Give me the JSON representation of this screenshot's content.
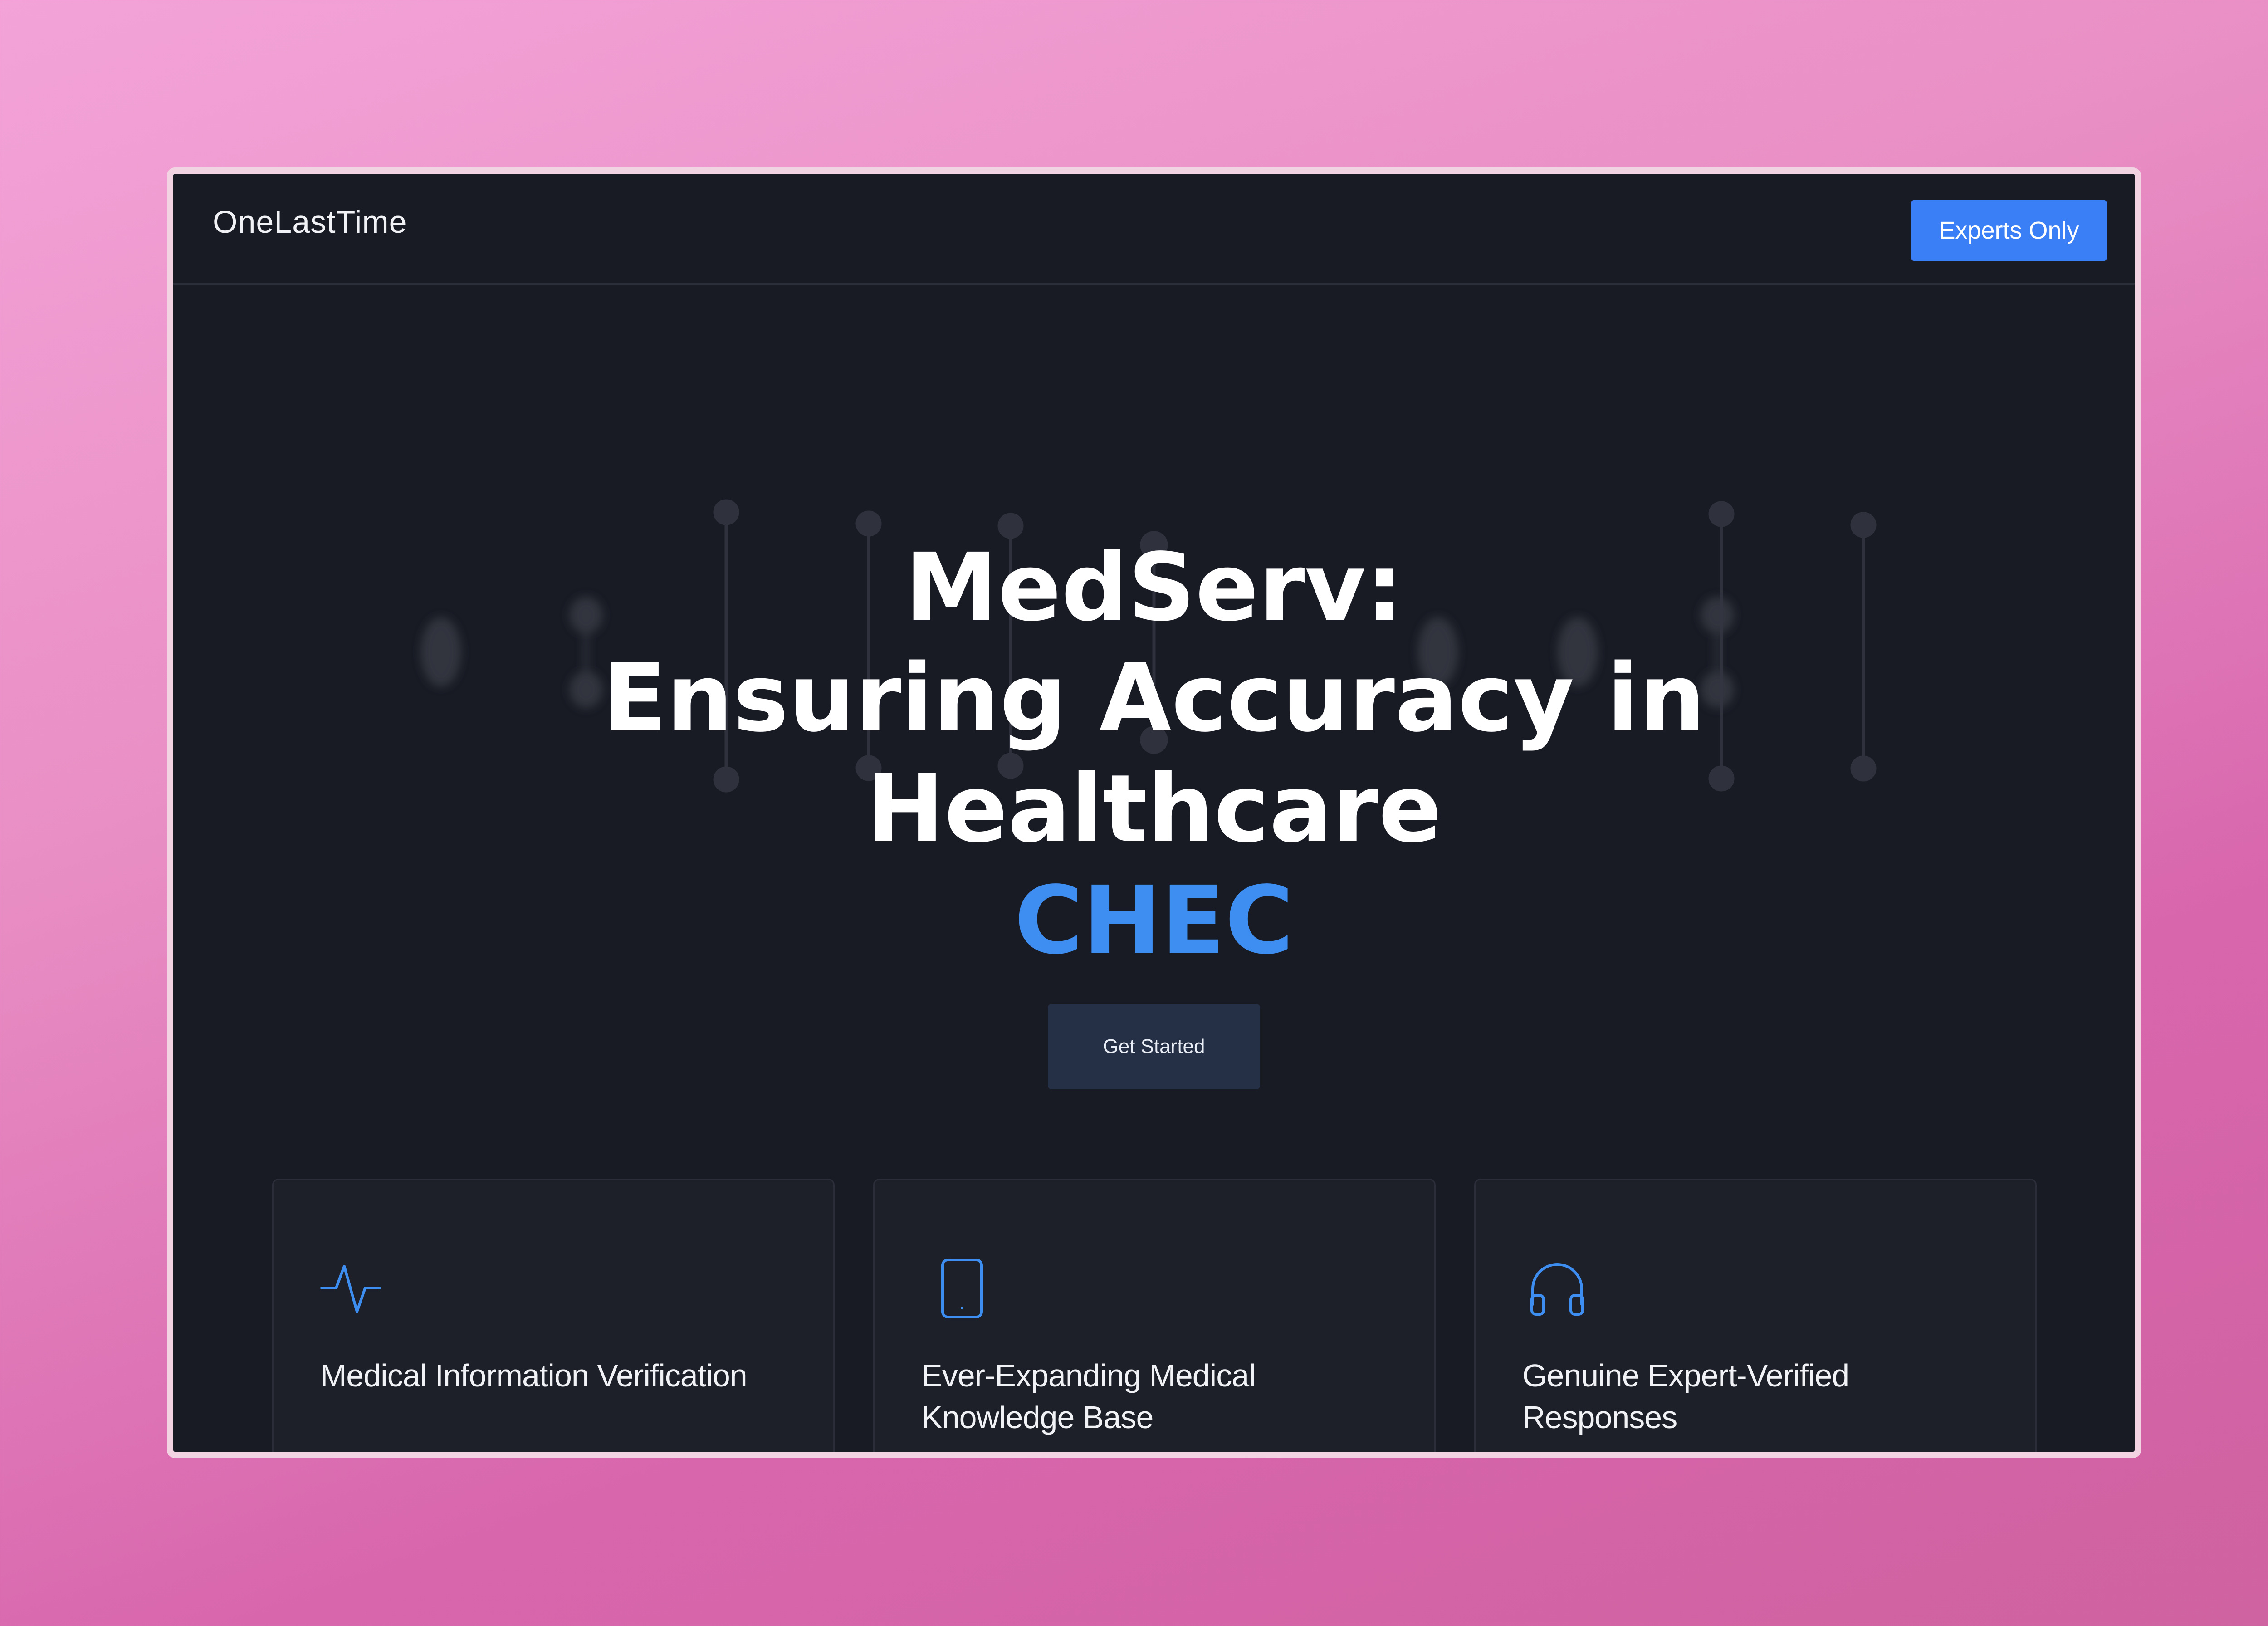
{
  "header": {
    "logo": "OneLastTime",
    "cta_label": "Experts Only"
  },
  "hero": {
    "title_line1": "MedServ:",
    "title_line2": "Ensuring Accuracy in",
    "title_line3": "Healthcare",
    "typed_word": "CHEC",
    "button_label": "Get Started"
  },
  "features": [
    {
      "icon": "pulse-icon",
      "title": "Medical Information Verification"
    },
    {
      "icon": "tablet-icon",
      "title": "Ever-Expanding Medical Knowledge Base"
    },
    {
      "icon": "headphones-icon",
      "title": "Genuine Expert-Verified Responses"
    }
  ],
  "colors": {
    "accent": "#3a7ff6",
    "highlight": "#3d8ef0",
    "background": "#181b24",
    "card": "#1e2029"
  }
}
